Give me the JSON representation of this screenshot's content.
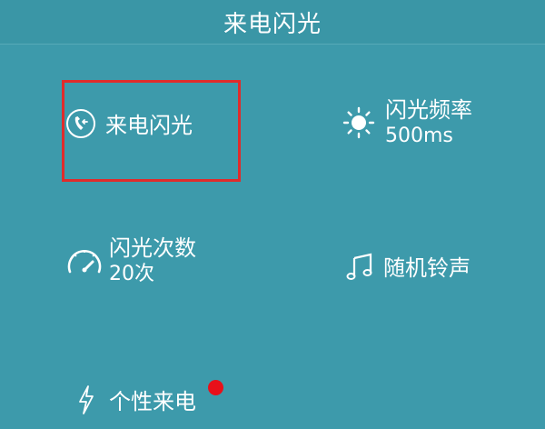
{
  "header": {
    "title": "来电闪光"
  },
  "items": {
    "incoming_flash": {
      "label": "来电闪光",
      "icon": "phone-incoming-icon"
    },
    "flash_frequency": {
      "label": "闪光频率",
      "value": "500ms",
      "icon": "sun-icon"
    },
    "flash_count": {
      "label": "闪光次数",
      "value": "20次",
      "icon": "speedometer-icon"
    },
    "random_ringtone": {
      "label": "随机铃声",
      "icon": "music-note-icon"
    },
    "personal_call": {
      "label": "个性来电",
      "icon": "lightning-icon",
      "badge_color": "#e8101a"
    }
  },
  "colors": {
    "background": "#3d9aab",
    "highlight": "#e02b2b",
    "text": "#ffffff"
  }
}
